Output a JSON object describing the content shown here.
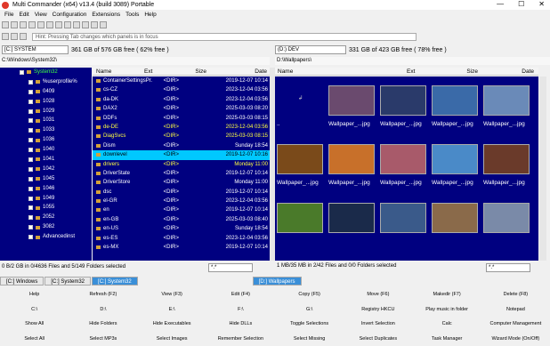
{
  "window": {
    "title": "Multi Commander (x64)  v13.4 (build 3089) Portable",
    "min": "—",
    "max": "☐",
    "close": "✕"
  },
  "menu": [
    "File",
    "Edit",
    "View",
    "Configuration",
    "Extensions",
    "Tools",
    "Help"
  ],
  "hint": "Hint: Pressing Tab changes which panels is in focus",
  "left": {
    "drive": "[C:] SYSTEM",
    "free": "361 GB of 576 GB free ( 62% free )",
    "path": "C:\\Windows\\System32\\",
    "tree": [
      "System32",
      "%userprofile%",
      "0409",
      "1028",
      "1029",
      "1031",
      "1033",
      "1036",
      "1040",
      "1041",
      "1042",
      "1045",
      "1046",
      "1049",
      "1055",
      "2052",
      "3082",
      "Advancedinst"
    ],
    "headers": {
      "name": "Name",
      "ext": "Ext",
      "size": "Size",
      "date": "Date"
    },
    "files": [
      {
        "name": "ContainerSettingsPr...",
        "size": "<DIR>",
        "date": "2019-12-07 10:14",
        "style": ""
      },
      {
        "name": "cs-CZ",
        "size": "<DIR>",
        "date": "2023-12-04 03:56",
        "style": ""
      },
      {
        "name": "da-DK",
        "size": "<DIR>",
        "date": "2023-12-04 03:56",
        "style": ""
      },
      {
        "name": "DAX2",
        "size": "<DIR>",
        "date": "2025-03-03 08:20",
        "style": ""
      },
      {
        "name": "DDFs",
        "size": "<DIR>",
        "date": "2025-03-03 08:15",
        "style": ""
      },
      {
        "name": "de-DE",
        "size": "<DIR>",
        "date": "2023-12-04 03:56",
        "style": "yellow"
      },
      {
        "name": "DiagSvcs",
        "size": "<DIR>",
        "date": "2025-03-03 08:15",
        "style": "yellow"
      },
      {
        "name": "Dism",
        "size": "<DIR>",
        "date": "Sunday 18:54",
        "style": ""
      },
      {
        "name": "downlevel",
        "size": "<DIR>",
        "date": "2019-12-07 10:16",
        "style": "sel"
      },
      {
        "name": "drivers",
        "size": "<DIR>",
        "date": "Monday 11:00",
        "style": "yellow"
      },
      {
        "name": "DriverState",
        "size": "<DIR>",
        "date": "2019-12-07 10:14",
        "style": ""
      },
      {
        "name": "DriverStore",
        "size": "<DIR>",
        "date": "Monday 11:00",
        "style": ""
      },
      {
        "name": "dsc",
        "size": "<DIR>",
        "date": "2019-12-07 10:14",
        "style": ""
      },
      {
        "name": "el-GR",
        "size": "<DIR>",
        "date": "2023-12-04 03:56",
        "style": ""
      },
      {
        "name": "en",
        "size": "<DIR>",
        "date": "2019-12-07 10:14",
        "style": ""
      },
      {
        "name": "en-GB",
        "size": "<DIR>",
        "date": "2025-03-03 08:40",
        "style": ""
      },
      {
        "name": "en-US",
        "size": "<DIR>",
        "date": "Sunday 18:54",
        "style": ""
      },
      {
        "name": "es-ES",
        "size": "<DIR>",
        "date": "2023-12-04 03:56",
        "style": ""
      },
      {
        "name": "es-MX",
        "size": "<DIR>",
        "date": "2019-12-07 10:14",
        "style": ""
      }
    ],
    "status": "0 B/2 GB in 0/4636 Files and 5/149 Folders selected",
    "filter": "*.*"
  },
  "right": {
    "drive": "(D:) DEV",
    "free": "331 GB of 423 GB free ( 78% free )",
    "path": "D:\\Wallpapers\\",
    "headers": {
      "name": "Name",
      "ext": "Ext",
      "size": "Size",
      "date": "Date"
    },
    "row1": [
      {
        "label": "..",
        "color": "#000080"
      },
      {
        "label": "Wallpaper_...jpg",
        "color": "#6a4a6e"
      },
      {
        "label": "Wallpaper_...jpg",
        "color": "#2a3a6a"
      },
      {
        "label": "Wallpaper_...jpg",
        "color": "#3a6aa8"
      },
      {
        "label": "Wallpaper_...jpg",
        "color": "#6a8ab8"
      }
    ],
    "row2": [
      {
        "label": "Wallpaper_...jpg",
        "color": "#7a4a1a"
      },
      {
        "label": "Wallpaper_...jpg",
        "color": "#c8702a"
      },
      {
        "label": "Wallpaper_...jpg",
        "color": "#a85a6a"
      },
      {
        "label": "Wallpaper_...jpg",
        "color": "#4a8ac8"
      },
      {
        "label": "Wallpaper_...jpg",
        "color": "#6a3a2a"
      }
    ],
    "row3": [
      {
        "label": "",
        "color": "#4a7a2a"
      },
      {
        "label": "",
        "color": "#1a2a4a"
      },
      {
        "label": "",
        "color": "#3a5a8a"
      },
      {
        "label": "",
        "color": "#8a6a4a"
      },
      {
        "label": "",
        "color": "#7a8aa8"
      }
    ],
    "status": "1 MB/35 MB in 2/42 Files and 0/0 Folders selected",
    "filter": "*.*"
  },
  "tabs_left": [
    "[C:] Windows",
    "[C:] System32",
    "[C:] System32"
  ],
  "tabs_right": [
    "[D:] Wallpapers"
  ],
  "fbar": [
    [
      "Help",
      "Refresh (F2)",
      "View (F3)",
      "Edit (F4)",
      "Copy (F5)",
      "Move (F6)",
      "Makedir (F7)",
      "Delete (F8)"
    ],
    [
      "C:\\",
      "D:\\",
      "E:\\",
      "F:\\",
      "G:\\",
      "Registry HKCU",
      "Play music in folder",
      "Notepad"
    ],
    [
      "Show All",
      "Hide Folders",
      "Hide Executables",
      "Hide DLLs",
      "Toggle Selections",
      "Invert Selection",
      "Calc",
      "Computer Management"
    ],
    [
      "Select All",
      "Select MP3s",
      "Select Images",
      "Remember Selection",
      "Select Missing",
      "Select Duplicates",
      "Task Manager",
      "Wizard Mode (On/Off)"
    ]
  ]
}
